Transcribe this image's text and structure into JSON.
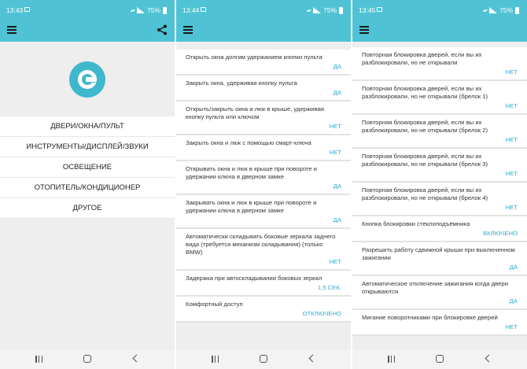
{
  "screen1": {
    "status": {
      "time": "13:43",
      "battery": "75%"
    },
    "menu": [
      "ДВЕРИ/ОКНА/ПУЛЬТ",
      "ИНСТРУМЕНТЫ/ДИСПЛЕЙ/ЗВУКИ",
      "ОСВЕЩЕНИЕ",
      "ОТОПИТЕЛЬ/КОНДИЦИОНЕР",
      "ДРУГОЕ"
    ]
  },
  "screen2": {
    "status": {
      "time": "13:44",
      "battery": "75%"
    },
    "settings": [
      {
        "label": "Открыть окна долгим удержанием кнопки пульта",
        "value": "ДА"
      },
      {
        "label": "Закрыть окна, удерживая кнопку пульта",
        "value": "ДА"
      },
      {
        "label": "Открыть/закрыть окна и люк в крыше, удерживая кнопку пульта или ключом",
        "value": "НЕТ"
      },
      {
        "label": "Закрыть окна и люк с помощью смарт-ключа",
        "value": "НЕТ"
      },
      {
        "label": "Открывать окна и люк в крыше при повороте и удержании ключа в дверном замке",
        "value": "ДА"
      },
      {
        "label": "Закрывать окна и люк в крыше при повороте и удержании ключа в дверном замке",
        "value": "ДА"
      },
      {
        "label": "Автоматически складывать боковые зеркала заднего вида (требуется механизм складывания) (только BMW)",
        "value": "НЕТ"
      },
      {
        "label": "Задержка при автоскладывании боковых зеркал",
        "value": "1,5 СЕК."
      },
      {
        "label": "Комфортный доступ",
        "value": "ОТКЛЮЧЕНО"
      }
    ]
  },
  "screen3": {
    "status": {
      "time": "13:45",
      "battery": "75%"
    },
    "settings": [
      {
        "label": "Повторная блокировка дверей, если вы их разблокировали, но не открывали",
        "value": "НЕТ"
      },
      {
        "label": "Повторная блокировка дверей, если вы их разблокировали, но не открывали (брелок 1)",
        "value": "НЕТ"
      },
      {
        "label": "Повторная блокировка дверей, если вы их разблокировали, но не открывали (брелок 2)",
        "value": "НЕТ"
      },
      {
        "label": "Повторная блокировка дверей, если вы их разблокировали, но не открывали (брелок 3)",
        "value": "НЕТ"
      },
      {
        "label": "Повторная блокировка дверей, если вы их разблокировали, но не открывали (брелок 4)",
        "value": "НЕТ"
      },
      {
        "label": "Кнопка блокировки стеклоподъёмника",
        "value": "ВКЛЮЧЕНО"
      },
      {
        "label": "Разрешить работу сдвижной крыши при выключенном зажигании",
        "value": "ДА"
      },
      {
        "label": "Автоматическое отключение зажигания когда двери открываются",
        "value": "ДА"
      },
      {
        "label": "Мигание поворотниками при блокировке дверей",
        "value": "НЕТ"
      }
    ]
  },
  "colors": {
    "accent": "#4fc3d5",
    "value_text": "#2eaad0"
  },
  "icons": [
    "menu-icon",
    "share-icon",
    "app-logo-icon",
    "recent-apps-icon",
    "home-icon",
    "back-icon"
  ]
}
